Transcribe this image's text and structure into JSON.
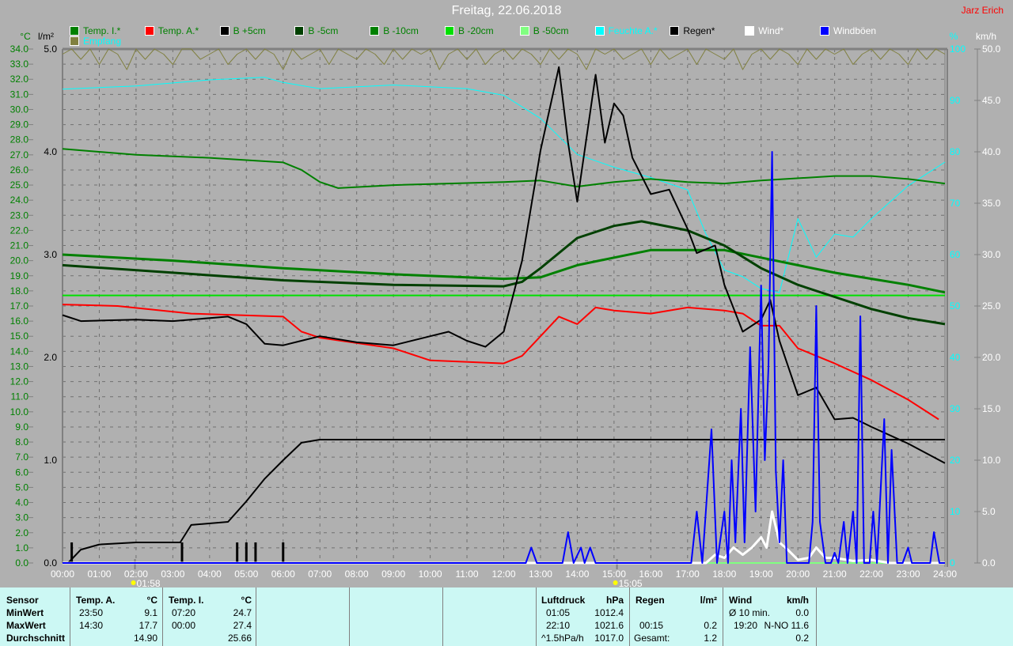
{
  "header": {
    "title": "Freitag, 22.06.2018",
    "author": "Jarz Erich"
  },
  "legend": [
    {
      "label": "Temp. I.*",
      "color": "#008000",
      "text_color": "#008000"
    },
    {
      "label": "Temp. A.*",
      "color": "#ff0000",
      "text_color": "#008000"
    },
    {
      "label": "B +5cm",
      "color": "#000000",
      "text_color": "#008000"
    },
    {
      "label": "B -5cm",
      "color": "#004000",
      "text_color": "#008000"
    },
    {
      "label": "B -10cm",
      "color": "#008000",
      "text_color": "#008000"
    },
    {
      "label": "B -20cm",
      "color": "#00e000",
      "text_color": "#008000"
    },
    {
      "label": "B -50cm",
      "color": "#80ff80",
      "text_color": "#008000"
    },
    {
      "label": "Feuchte A.*",
      "color": "#00ffff",
      "text_color": "#00ffff"
    },
    {
      "label": "Regen*",
      "color": "#000000",
      "text_color": "#000000"
    },
    {
      "label": "Wind*",
      "color": "#ffffff",
      "text_color": "#ffffff"
    },
    {
      "label": "Windböen",
      "color": "#0000ff",
      "text_color": "#ffffff"
    },
    {
      "label": "Empfang",
      "color": "#808040",
      "text_color": "#00ffff"
    }
  ],
  "chart_data": {
    "type": "line",
    "title": "Freitag, 22.06.2018",
    "x": {
      "label": "",
      "range": [
        "00:00",
        "24:00"
      ],
      "tick_step_hours": 1
    },
    "axes": {
      "temp": {
        "unit": "°C",
        "range": [
          0,
          34
        ],
        "step": 1,
        "color": "#008000"
      },
      "rain": {
        "unit": "l/m²",
        "range": [
          0,
          5
        ],
        "step": 1,
        "color": "#000000"
      },
      "percent": {
        "unit": "%",
        "range": [
          0,
          100
        ],
        "step": 10,
        "color": "#00ffff"
      },
      "wind": {
        "unit": "km/h",
        "range": [
          0,
          50
        ],
        "step": 5,
        "color": "#ffffff"
      }
    },
    "grid": true,
    "markers": [
      {
        "time": "01:58",
        "hour": 1.97
      },
      {
        "time": "15:05",
        "hour": 15.08
      }
    ],
    "series": [
      {
        "name": "Empfang",
        "axis": "percent",
        "color": "#808040",
        "width": 1,
        "t_step": 0.25,
        "v": [
          99,
          100,
          98,
          100,
          97,
          100,
          99,
          96,
          100,
          98,
          100,
          99,
          97,
          100,
          100,
          98,
          99,
          100,
          97,
          99,
          100,
          98,
          100,
          99,
          96,
          100,
          98,
          99,
          100,
          97,
          100,
          99,
          98,
          100,
          99,
          97,
          100,
          98,
          100,
          99,
          100,
          96,
          99,
          100,
          98,
          100,
          97,
          99,
          100,
          98,
          100,
          99,
          97,
          100,
          98,
          100,
          99,
          96,
          100,
          99,
          100,
          98,
          99,
          100,
          97,
          100,
          98,
          99,
          100,
          97,
          100,
          99,
          98,
          100,
          96,
          99,
          100,
          98,
          100,
          99,
          97,
          100,
          98,
          100,
          99,
          100,
          97,
          99,
          100,
          98,
          100,
          99,
          97,
          100,
          98,
          100,
          99
        ]
      },
      {
        "name": "Feuchte A.",
        "axis": "percent",
        "color": "#00ffff",
        "width": 1,
        "t": [
          0,
          2,
          4,
          5.5,
          6,
          7,
          9,
          11,
          12,
          13,
          14,
          15,
          16,
          17,
          17.5,
          18,
          18.5,
          19,
          19.5,
          20,
          20.5,
          21,
          21.5,
          22,
          23,
          24
        ],
        "v": [
          92.2,
          92.8,
          94,
          94.5,
          93.5,
          92.3,
          93,
          92.3,
          91,
          86.5,
          79.5,
          77,
          75,
          72.6,
          64,
          57,
          55.7,
          53.4,
          52.6,
          67,
          59.5,
          64,
          63.4,
          67,
          73.4,
          78
        ]
      },
      {
        "name": "Temp. I.",
        "axis": "temp",
        "color": "#008000",
        "width": 2,
        "t": [
          0,
          2,
          4,
          6,
          6.5,
          7,
          7.5,
          9,
          12,
          13,
          14,
          15,
          16,
          17,
          18,
          19,
          21,
          22,
          23,
          24
        ],
        "v": [
          27.4,
          27.0,
          26.8,
          26.5,
          26.0,
          25.2,
          24.8,
          25.0,
          25.2,
          25.3,
          24.9,
          25.2,
          25.4,
          25.2,
          25.1,
          25.3,
          25.6,
          25.6,
          25.4,
          25.1
        ]
      },
      {
        "name": "B -20cm",
        "axis": "temp",
        "color": "#00e000",
        "width": 2,
        "t": [
          0,
          24
        ],
        "v": [
          17.7,
          17.7
        ]
      },
      {
        "name": "B -10cm",
        "axis": "temp",
        "color": "#008000",
        "width": 3,
        "t": [
          0,
          3,
          6,
          9,
          12,
          13,
          14,
          15,
          16,
          18,
          19,
          20,
          21,
          22,
          23,
          24
        ],
        "v": [
          20.4,
          20.0,
          19.5,
          19.1,
          18.8,
          18.9,
          19.7,
          20.2,
          20.7,
          20.7,
          20.2,
          19.7,
          19.2,
          18.8,
          18.4,
          17.9
        ]
      },
      {
        "name": "B -5cm",
        "axis": "temp",
        "color": "#004000",
        "width": 3,
        "t": [
          0,
          3,
          6,
          9,
          12,
          12.5,
          13,
          14,
          15,
          15.75,
          17,
          18,
          19,
          20,
          21,
          22,
          23,
          24
        ],
        "v": [
          19.7,
          19.2,
          18.7,
          18.4,
          18.3,
          18.6,
          19.5,
          21.5,
          22.3,
          22.6,
          22.0,
          21.0,
          19.5,
          18.4,
          17.6,
          16.8,
          16.2,
          15.8
        ]
      },
      {
        "name": "Temp. A.",
        "axis": "temp",
        "color": "#ff0000",
        "width": 2,
        "t": [
          0,
          1.5,
          3.5,
          6,
          6.5,
          7,
          9,
          10,
          12,
          12.5,
          13,
          13.5,
          14,
          14.5,
          15,
          16,
          17,
          18,
          18.5,
          19,
          19.5,
          20,
          20.5,
          21,
          22,
          23,
          23.83
        ],
        "v": [
          17.1,
          17.0,
          16.5,
          16.3,
          15.3,
          14.9,
          14.2,
          13.4,
          13.2,
          13.7,
          15.0,
          16.3,
          15.8,
          16.9,
          16.7,
          16.5,
          16.9,
          16.7,
          16.5,
          15.7,
          15.7,
          14.2,
          13.7,
          13.2,
          12.1,
          10.8,
          9.5
        ]
      },
      {
        "name": "B +5cm",
        "axis": "temp",
        "color": "#000000",
        "width": 2,
        "t": [
          0,
          0.5,
          2,
          3,
          4.5,
          5,
          5.5,
          6,
          7,
          8,
          9,
          10,
          10.5,
          11,
          11.5,
          12,
          12.5,
          13,
          13.5,
          13.75,
          14,
          14.5,
          14.75,
          15,
          15.25,
          15.5,
          16,
          16.5,
          17,
          17.25,
          17.75,
          18,
          18.5,
          19,
          19.25,
          19.5,
          20,
          20.5,
          21,
          21.5,
          22,
          23,
          24
        ],
        "v": [
          16.4,
          16.0,
          16.1,
          16.0,
          16.3,
          15.8,
          14.5,
          14.4,
          15.0,
          14.6,
          14.4,
          15.0,
          15.3,
          14.7,
          14.3,
          15.3,
          20.0,
          27.3,
          32.8,
          27.8,
          23.9,
          32.3,
          27.8,
          30.4,
          29.6,
          26.8,
          24.4,
          24.7,
          22.1,
          20.5,
          21.0,
          18.4,
          15.3,
          16.1,
          17.4,
          14.7,
          11.1,
          11.6,
          9.5,
          9.6,
          9.0,
          7.9,
          6.6
        ]
      },
      {
        "name": "Regen",
        "axis": "rain",
        "color": "#000000",
        "width": 2,
        "t": [
          0.15,
          0.5,
          1,
          2,
          3.2,
          3.5,
          4.5,
          5,
          5.5,
          6,
          6.5,
          7,
          24
        ],
        "v": [
          0,
          0.13,
          0.18,
          0.2,
          0.2,
          0.37,
          0.4,
          0.6,
          0.82,
          1.0,
          1.17,
          1.2,
          1.2
        ]
      },
      {
        "name": "Wind",
        "axis": "wind",
        "color": "#ffffff",
        "width": 3,
        "t": [
          0,
          17.5,
          17.75,
          18,
          18.25,
          18.5,
          18.75,
          19,
          19.15,
          19.3,
          19.5,
          19.75,
          20,
          20.3,
          20.5,
          20.75,
          21,
          21.5,
          22,
          22.5,
          24
        ],
        "v": [
          0,
          0,
          0.8,
          0.5,
          1.5,
          0.8,
          1.5,
          2.5,
          1.5,
          5,
          2,
          1.2,
          0.3,
          0.5,
          1.5,
          0.5,
          0.5,
          0.2,
          0.3,
          0,
          0
        ]
      },
      {
        "name": "Windböen",
        "axis": "wind",
        "color": "#0000ff",
        "width": 2,
        "t": [
          0,
          12.6,
          12.75,
          12.9,
          13.6,
          13.75,
          13.9,
          14.1,
          14.2,
          14.35,
          14.5,
          17.1,
          17.25,
          17.4,
          17.65,
          17.8,
          18,
          18.1,
          18.2,
          18.3,
          18.45,
          18.55,
          18.7,
          18.85,
          19,
          19.1,
          19.2,
          19.3,
          19.4,
          19.5,
          19.6,
          19.7,
          19.8,
          19.95,
          20.3,
          20.4,
          20.5,
          20.6,
          20.75,
          20.9,
          21,
          21.1,
          21.25,
          21.35,
          21.5,
          21.6,
          21.7,
          21.8,
          21.95,
          22.05,
          22.15,
          22.35,
          22.45,
          22.55,
          22.7,
          22.85,
          23,
          23.1,
          23.2,
          23.6,
          23.7,
          23.85,
          24
        ],
        "v": [
          0,
          0,
          1.5,
          0,
          0,
          3,
          0,
          1.5,
          0,
          1.5,
          0,
          0,
          5,
          0,
          13,
          0,
          5,
          0,
          10,
          2,
          15,
          2,
          21,
          5,
          27,
          10,
          19,
          40,
          9,
          2,
          10,
          0,
          0,
          0,
          0,
          4,
          25,
          4,
          0,
          0,
          1,
          0,
          4,
          0,
          5,
          0,
          24,
          0,
          0,
          5,
          0,
          14,
          0,
          11,
          0,
          0,
          1.5,
          0,
          0,
          0,
          3,
          0,
          0
        ]
      }
    ],
    "rain_events": [
      {
        "hour": 0.25,
        "value": 0.2
      },
      {
        "hour": 3.25,
        "value": 0.2
      },
      {
        "hour": 4.75,
        "value": 0.2
      },
      {
        "hour": 5.0,
        "value": 0.2
      },
      {
        "hour": 5.25,
        "value": 0.2
      },
      {
        "hour": 6.0,
        "value": 0.2
      }
    ]
  },
  "table": {
    "sensor": {
      "header": "Sensor",
      "rows": [
        "MinWert",
        "MaxWert",
        "Durchschnitt"
      ]
    },
    "temp_a": {
      "header": "Temp. A.",
      "unit": "°C",
      "min_time": "23:50",
      "min": "9.1",
      "max_time": "14:30",
      "max": "17.7",
      "avg": "14.90"
    },
    "temp_i": {
      "header": "Temp. I.",
      "unit": "°C",
      "min_time": "07:20",
      "min": "24.7",
      "max_time": "00:00",
      "max": "27.4",
      "avg": "25.66"
    },
    "pressure": {
      "header": "Luftdruck",
      "unit": "hPa",
      "min_time": "01:05",
      "min": "1012.4",
      "max_time": "22:10",
      "max": "1021.6",
      "trend": "^1.5hPa/h",
      "avg": "1017.0"
    },
    "rain": {
      "header": "Regen",
      "unit": "l/m²",
      "max_time": "00:15",
      "max": "0.2",
      "total_label": "Gesamt:",
      "total": "1.2"
    },
    "wind": {
      "header": "Wind",
      "unit": "km/h",
      "avg_label": "Ø 10 min.",
      "avg": "0.0",
      "max_time": "19:20",
      "max": "N-NO 11.6",
      "last": "0.2"
    }
  }
}
